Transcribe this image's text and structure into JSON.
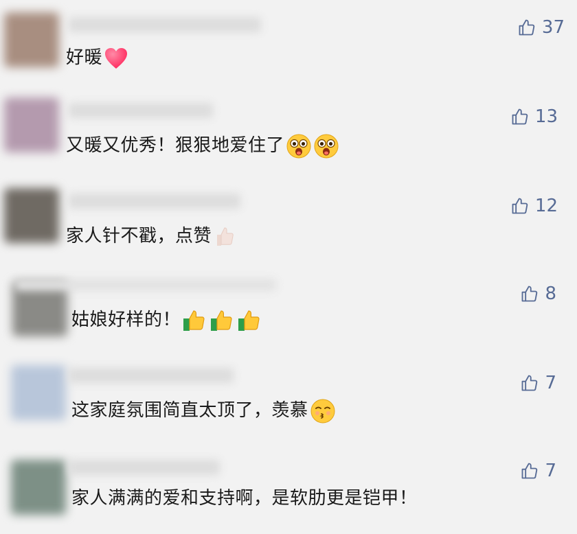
{
  "comments": [
    {
      "text": "好暖",
      "likes": "37",
      "emojis": [
        "red-heart-icon"
      ]
    },
    {
      "text": "又暖又优秀！狠狠地爱住了",
      "likes": "13",
      "emojis": [
        "surprised-face-icon",
        "surprised-face-icon"
      ]
    },
    {
      "text": "家人针不戳，点赞",
      "likes": "12",
      "emojis": [
        "thumbs-up-icon"
      ]
    },
    {
      "text": "姑娘好样的！",
      "likes": "8",
      "emojis": [
        "thumbs-up-icon",
        "thumbs-up-icon",
        "thumbs-up-icon"
      ]
    },
    {
      "text": "这家庭氛围简直太顶了，羡慕",
      "likes": "7",
      "emojis": [
        "kissing-face-icon"
      ]
    },
    {
      "text": "家人满满的爱和支持啊，是软肋更是铠甲！",
      "likes": "7",
      "emojis": []
    }
  ],
  "colors": {
    "background": "#f2f2f2",
    "like_accent": "#576b95",
    "text": "#1a1a1a"
  }
}
